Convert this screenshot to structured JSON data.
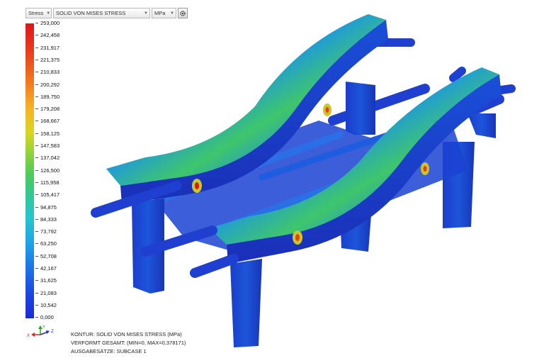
{
  "toolbar": {
    "result_type": "Stress",
    "result_component": "SOLID VON MISES STRESS",
    "unit": "MPa",
    "options_icon": "gear-icon"
  },
  "legend": {
    "values": [
      "253,000",
      "242,458",
      "231,917",
      "221,375",
      "210,833",
      "200,292",
      "189,750",
      "179,208",
      "168,667",
      "158,125",
      "147,583",
      "137,042",
      "126,500",
      "115,958",
      "105,417",
      "94,875",
      "84,333",
      "73,792",
      "63,250",
      "52,708",
      "42,167",
      "31,625",
      "21,083",
      "10,542",
      "0,000"
    ],
    "colors": {
      "max": "#e0151b",
      "mid": "#4ecb58",
      "min": "#1a2ad8"
    }
  },
  "triad": {
    "x": "X",
    "y": "Y",
    "z": "Z"
  },
  "footer": {
    "line1": "KONTUR: SOLID VON MISES STRESS (MPa)",
    "line2": "VERFORMT GESAMT: (MIN=0, MAX=0,378171)",
    "line3": "AUSGABESÄTZE: SUBCASE 1"
  }
}
